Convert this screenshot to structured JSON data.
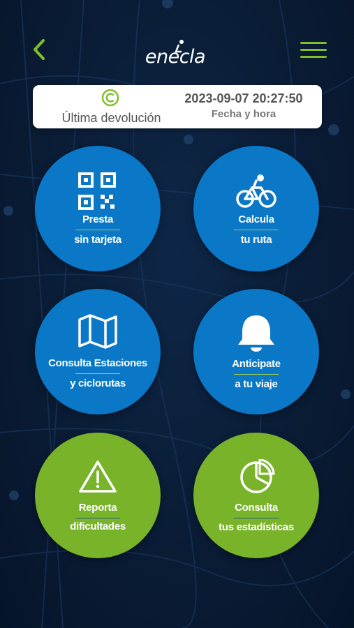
{
  "header": {
    "logo_text": "enecla",
    "back_icon": "chevron-left-icon",
    "menu_icon": "hamburger-menu-icon",
    "accent_color": "#7fbf2a"
  },
  "last_return": {
    "label": "Última devolución",
    "datetime": "2023-09-07 20:27:50",
    "datetime_label": "Fecha y hora",
    "icon": "copyright-circle-icon"
  },
  "actions": [
    {
      "line1": "Presta",
      "line2": "sin tarjeta",
      "icon": "qr-code-icon",
      "color": "#0a78c7"
    },
    {
      "line1": "Calcula",
      "line2": "tu ruta",
      "icon": "cyclist-icon",
      "color": "#0a78c7"
    },
    {
      "line1": "Consulta Estaciones",
      "line2": "y ciclorutas",
      "icon": "map-icon",
      "color": "#0a78c7"
    },
    {
      "line1": "Anticipate",
      "line2": "a tu viaje",
      "icon": "bell-icon",
      "color": "#0a78c7"
    },
    {
      "line1": "Reporta",
      "line2": "dificultades",
      "icon": "warning-icon",
      "color": "#79b32a"
    },
    {
      "line1": "Consulta",
      "line2": "tus estadísticas",
      "icon": "pie-chart-icon",
      "color": "#79b32a"
    }
  ]
}
